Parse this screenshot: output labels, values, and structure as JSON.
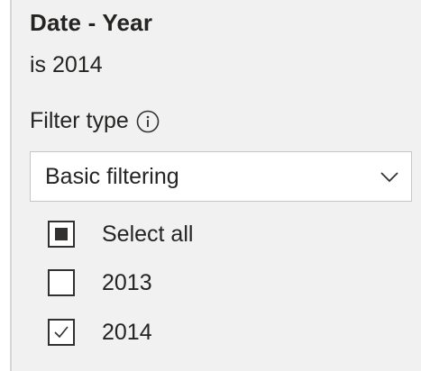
{
  "filter_card": {
    "title": "Date - Year",
    "summary": "is 2014",
    "filter_type_label": "Filter type",
    "filter_type_value": "Basic filtering",
    "options": [
      {
        "label": "Select all",
        "state": "indeterminate"
      },
      {
        "label": "2013",
        "state": "unchecked"
      },
      {
        "label": "2014",
        "state": "checked"
      }
    ]
  },
  "icons": {
    "info": "info-icon",
    "dropdown": "chevron-down-icon"
  },
  "colors": {
    "pane_background": "#f1f1f1",
    "text": "#252423",
    "checkbox_border": "#323130"
  }
}
